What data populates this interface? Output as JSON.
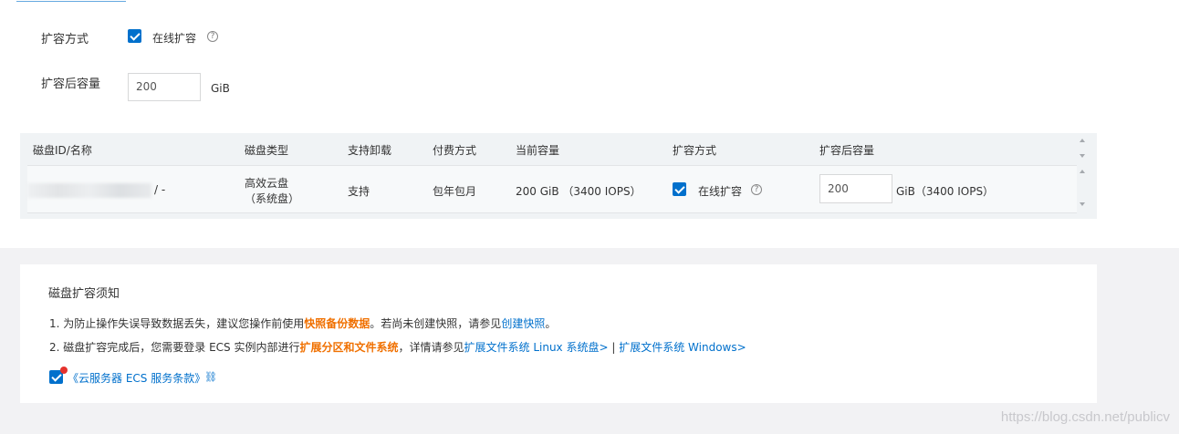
{
  "form": {
    "expand_method_label": "扩容方式",
    "online_expand_label": "在线扩容",
    "after_capacity_label": "扩容后容量",
    "after_capacity_value": "200",
    "unit": "GiB"
  },
  "table": {
    "headers": [
      "磁盘ID/名称",
      "磁盘类型",
      "支持卸载",
      "付费方式",
      "当前容量",
      "扩容方式",
      "扩容后容量"
    ],
    "row": {
      "disk_id_suffix": "/ -",
      "disk_type_line1": "高效云盘",
      "disk_type_line2": "（系统盘）",
      "detachable": "支持",
      "billing": "包年包月",
      "current_capacity": "200 GiB （3400 IOPS）",
      "expand_method": "在线扩容",
      "after_capacity_value": "200",
      "after_capacity_unit": "GiB（3400 IOPS）"
    }
  },
  "notice": {
    "title": "磁盘扩容须知",
    "line1_a": "1. 为防止操作失误导致数据丢失，建议您操作前使用",
    "line1_b": "快照备份数据",
    "line1_c": "。若尚未创建快照，请参见",
    "line1_d": "创建快照",
    "line1_e": "。",
    "line2_a": "2. 磁盘扩容完成后，您需要登录 ECS 实例内部进行",
    "line2_b": "扩展分区和文件系统",
    "line2_c": "，详情请参见",
    "line2_d": "扩展文件系统 Linux 系统盘>",
    "line2_e": " | ",
    "line2_f": "扩展文件系统 Windows>",
    "terms_link": "《云服务器 ECS 服务条款》"
  },
  "watermark": "https://blog.csdn.net/publicv",
  "icons": {
    "help": "question-circle-icon",
    "link": "link-icon",
    "check": "checkbox-checked-icon"
  },
  "colors": {
    "primary": "#0070cc",
    "warning": "#f07000"
  }
}
